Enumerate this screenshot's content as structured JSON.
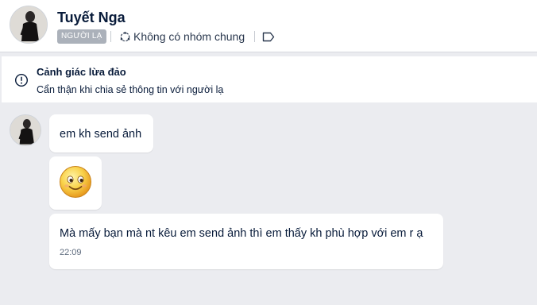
{
  "header": {
    "name": "Tuyết Nga",
    "badge": "NGƯỜI LẠ",
    "common_groups": "Không có nhóm chung"
  },
  "warning": {
    "title": "Cảnh giác lừa đảo",
    "text": "Cẩn thận khi chia sẻ thông tin với người lạ"
  },
  "messages": [
    {
      "text": "em kh send ảnh"
    },
    {
      "sticker": "smiling-face-emoji"
    },
    {
      "text": "Mà mấy bạn mà nt kêu em send ảnh thì em thấy kh phù hợp với em r ạ",
      "time": "22:09"
    }
  ],
  "colors": {
    "background": "#ebecf0",
    "surface": "#ffffff",
    "text": "#081b3a",
    "badge": "#abb1ba",
    "muted": "#5e6b7e"
  }
}
